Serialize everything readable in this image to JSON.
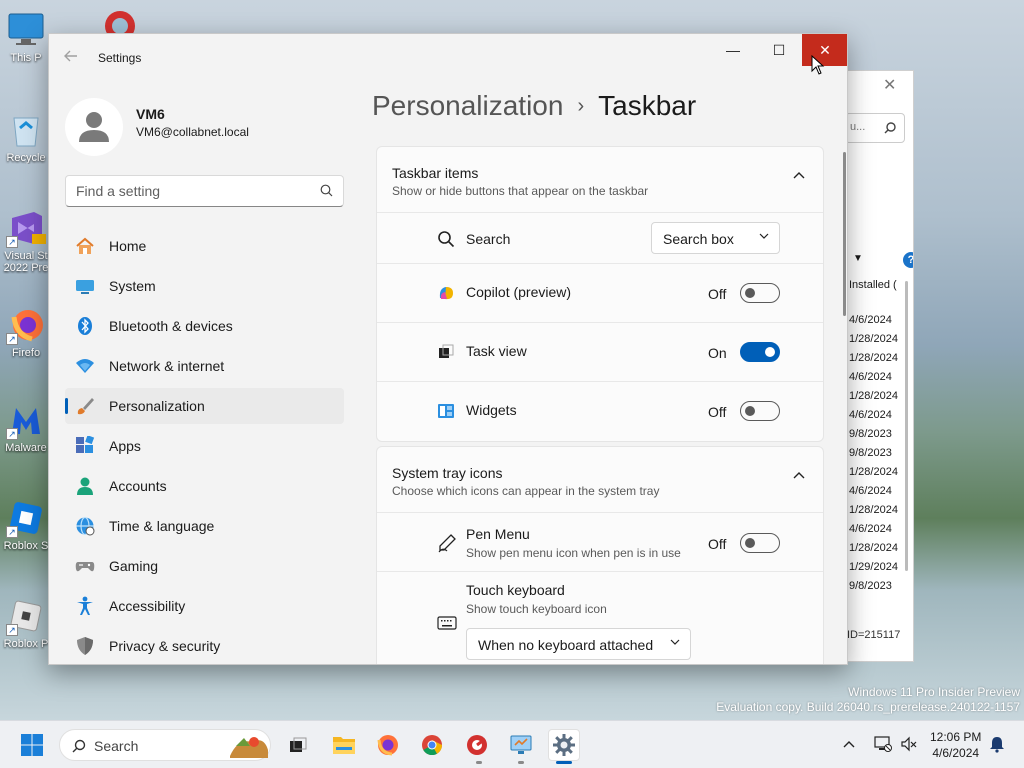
{
  "desktop": {
    "icons": [
      {
        "label": "This P",
        "name": "this-pc"
      },
      {
        "label": "Recycle",
        "name": "recycle-bin"
      },
      {
        "label": "Visual St",
        "label2": "2022 Pre",
        "name": "visual-studio"
      },
      {
        "label": "Firefo",
        "name": "firefox"
      },
      {
        "label": "Malware",
        "name": "malwarebytes"
      },
      {
        "label": "Roblox S",
        "name": "roblox-studio"
      },
      {
        "label": "Roblox P",
        "name": "roblox-player"
      }
    ],
    "watermark_line1": "Windows 11 Pro Insider Preview",
    "watermark_line2": "Evaluation copy. Build 26040.rs_prerelease.240122-1157"
  },
  "background_window": {
    "search_text": "u...",
    "help": "?",
    "column_header": "Installed (",
    "dates": [
      "4/6/2024",
      "1/28/2024",
      "1/28/2024",
      "4/6/2024",
      "1/28/2024",
      "4/6/2024",
      "9/8/2023",
      "9/8/2023",
      "1/28/2024",
      "4/6/2024",
      "1/28/2024",
      "4/6/2024",
      "1/28/2024",
      "1/29/2024",
      "9/8/2023"
    ],
    "id_text": "ID=215117"
  },
  "window": {
    "title": "Settings",
    "minimize": "—",
    "maximize": "☐",
    "close": "✕"
  },
  "profile": {
    "name": "VM6",
    "email": "VM6@collabnet.local"
  },
  "search": {
    "placeholder": "Find a setting"
  },
  "nav": {
    "items": [
      {
        "label": "Home",
        "icon": "home-icon",
        "active": false
      },
      {
        "label": "System",
        "icon": "system-icon",
        "active": false
      },
      {
        "label": "Bluetooth & devices",
        "icon": "bluetooth-icon",
        "active": false
      },
      {
        "label": "Network & internet",
        "icon": "network-icon",
        "active": false
      },
      {
        "label": "Personalization",
        "icon": "brush-icon",
        "active": true
      },
      {
        "label": "Apps",
        "icon": "apps-icon",
        "active": false
      },
      {
        "label": "Accounts",
        "icon": "accounts-icon",
        "active": false
      },
      {
        "label": "Time & language",
        "icon": "globe-icon",
        "active": false
      },
      {
        "label": "Gaming",
        "icon": "gamepad-icon",
        "active": false
      },
      {
        "label": "Accessibility",
        "icon": "accessibility-icon",
        "active": false
      },
      {
        "label": "Privacy & security",
        "icon": "shield-icon",
        "active": false
      }
    ]
  },
  "breadcrumb": {
    "parent": "Personalization",
    "separator": "›",
    "current": "Taskbar"
  },
  "taskbar_items": {
    "title": "Taskbar items",
    "subtitle": "Show or hide buttons that appear on the taskbar",
    "search_label": "Search",
    "search_value": "Search box",
    "copilot_label": "Copilot (preview)",
    "copilot_state": "Off",
    "taskview_label": "Task view",
    "taskview_state": "On",
    "widgets_label": "Widgets",
    "widgets_state": "Off"
  },
  "system_tray": {
    "title": "System tray icons",
    "subtitle": "Choose which icons can appear in the system tray",
    "pen_label": "Pen Menu",
    "pen_sub": "Show pen menu icon when pen is in use",
    "pen_state": "Off",
    "touch_label": "Touch keyboard",
    "touch_sub": "Show touch keyboard icon",
    "touch_value": "When no keyboard attached"
  },
  "taskbar": {
    "search_label": "Search",
    "time": "12:06 PM",
    "date": "4/6/2024"
  },
  "colors": {
    "accent": "#005fb8",
    "close_red": "#c42b1c"
  }
}
